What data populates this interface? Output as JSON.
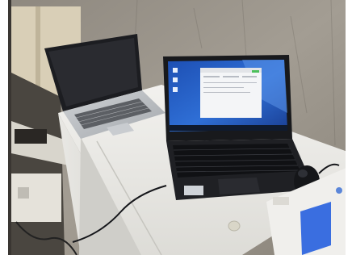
{
  "photo": {
    "subject": "two-laptops-on-white-cabinet",
    "palette": {
      "wall": "#9a948a",
      "cabinet": "#e7e6e2",
      "dark_laptop": "#1d1e22",
      "silver_laptop": "#b9bcc0",
      "screen_blue": "#2a63c9",
      "device_screen": "#3a6ee0"
    }
  },
  "icons": {
    "desktop_icons": [
      "app-icon",
      "app-icon",
      "app-icon"
    ]
  }
}
